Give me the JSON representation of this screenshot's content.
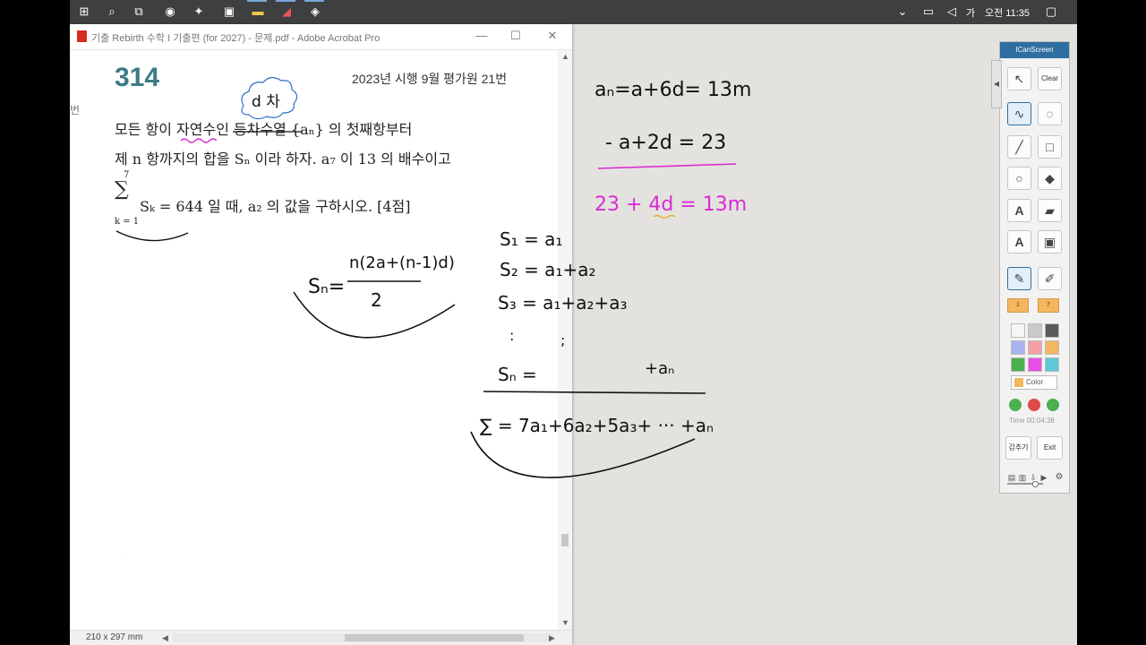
{
  "taskbar": {
    "clock": "오전 11:35",
    "ime": "가",
    "icons": [
      "windows-start-icon",
      "search-icon",
      "task-view-icon",
      "media-player-icon",
      "bird-app-icon",
      "briefcase-icon",
      "file-explorer-icon",
      "acrobat-icon",
      "game-icon"
    ]
  },
  "acrobat": {
    "title": "기출 Rebirth 수학 I  기출편 (for 2027) - 문제.pdf - Adobe Acrobat Pro",
    "minimize": "—",
    "maximize": "☐",
    "close": "✕",
    "page_size": "210 x 297 mm",
    "side_char": "번"
  },
  "problem": {
    "number": "314",
    "source": "2023년 시행 9월 평가원 21번",
    "line1": "모든 항이 자연수인 등차수열 {aₙ} 의 첫째항부터",
    "line2": "제 n 항까지의 합을 Sₙ 이라 하자. a₇ 이 13 의 배수이고",
    "line3": "Sₖ = 644 일 때, a₂ 의 값을 구하시오. [4점]",
    "sigma": "∑",
    "sigma_top": "7",
    "sigma_bottom": "k = 1"
  },
  "annotations": {
    "bubble": "d 차",
    "sn_formula_left": "Sₙ=",
    "sn_numerator": "n(2a+(n-1)d)",
    "sn_denominator": "2",
    "s1": "S₁ = a₁",
    "s2": "S₂ = a₁+a₂",
    "s3": "S₃ = a₁+a₂+a₃",
    "dots": ":",
    "dots2": ";",
    "sn": "Sₙ =",
    "plus_an": "+aₙ",
    "sigma_sum": "∑  = 7a₁+6a₂+5a₃+ ··· +aₙ",
    "eq1": "aₙ=a+6d= 13m",
    "eq2": "-  a+2d = 23",
    "eq3": "23 + 4d = 13m"
  },
  "toolbar": {
    "title": "ICanScreen",
    "clear": "Clear",
    "text_tool": "A",
    "text_stamp": "A",
    "size1": "1",
    "size2": "7",
    "color_label": "Color",
    "time": "Time 00:04:38",
    "hide": "감추기",
    "exit": "Exit",
    "accent": "#2f6ea0",
    "swatches": [
      "#f5f5f5",
      "#c9c9c9",
      "#5a5a5a",
      "#a8b4f0",
      "#f4a0a8",
      "#f4b65e",
      "#4caf50",
      "#e94ee9",
      "#5cc8d8"
    ]
  },
  "ink_colors": {
    "black": "#111111",
    "magenta": "#d92bd2",
    "orange": "#f0a830",
    "blue": "#2a6fc9"
  }
}
